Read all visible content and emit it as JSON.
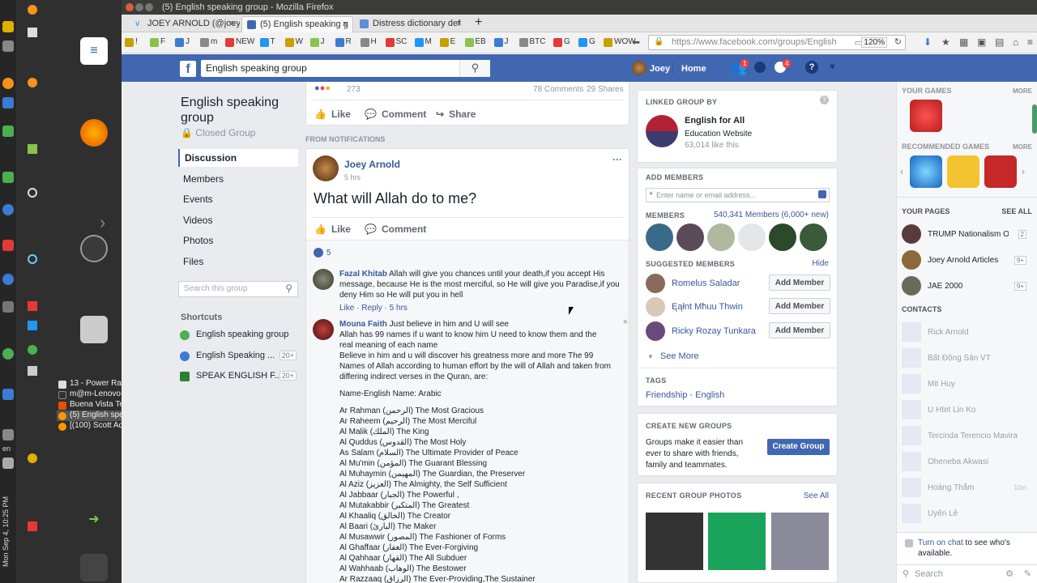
{
  "window": {
    "title": "(5) English speaking group - Mozilla Firefox"
  },
  "tabs": [
    {
      "label": "JOEY ARNOLD (@joey"
    },
    {
      "label": "(5) English speaking g"
    },
    {
      "label": "Distress dictionary def"
    }
  ],
  "bookmarks": [
    "!",
    "F",
    "J",
    "m",
    "NEW",
    "T",
    "W",
    "J",
    "R",
    "H",
    "SC",
    "M",
    "E",
    "EB",
    "J",
    "BTC",
    "G",
    "G",
    "WOW"
  ],
  "url": {
    "value": "https://www.facebook.com/groups/English",
    "zoom": "120%"
  },
  "taskbar": {
    "items": [
      "13 - Power Ran...",
      "m@m-Lenovo-...",
      "Buena Vista Te...",
      "(5) English spe...",
      "[(100) Scott Ad..."
    ],
    "clock": "Mon Sep 4, 10:25 PM",
    "lang": "en"
  },
  "fb": {
    "search_value": "English speaking group",
    "user": "Joey",
    "home": "Home",
    "friends_badge": "1",
    "notif_badge": "4"
  },
  "group": {
    "name": "English speaking group",
    "type": "Closed Group",
    "nav": [
      "Discussion",
      "Members",
      "Events",
      "Videos",
      "Photos",
      "Files"
    ],
    "search_placeholder": "Search this group",
    "shortcuts_title": "Shortcuts",
    "shortcuts": [
      {
        "label": "English speaking group",
        "count": ""
      },
      {
        "label": "English Speaking ...",
        "count": "20+"
      },
      {
        "label": "SPEAK ENGLISH F...",
        "count": "20+"
      }
    ]
  },
  "topcard": {
    "reactions": "273",
    "comments": "78 Comments",
    "shares": "29 Shares",
    "like": "Like",
    "comment": "Comment",
    "share": "Share"
  },
  "from_notifications": "FROM NOTIFICATIONS",
  "post": {
    "author": "Joey Arnold",
    "time": "5 hrs",
    "more": "···",
    "text": "What will Allah do to me?",
    "like": "Like",
    "comment": "Comment",
    "likes_count": "5"
  },
  "comments": [
    {
      "name": "Fazal Khitab",
      "text": "Allah will give you chances until your death,if you accept His message, because He is the most merciful, so He will give you Paradise,if you deny Him so He will put you in hell",
      "meta": "Like · Reply · 5 hrs"
    },
    {
      "name": "Mouna Faith",
      "first": "Just believe in him and U will see",
      "lines": [
        "Allah has 99 names if u want to know him U need to know them and the real meaning of each name",
        "Believe in him and u will discover his greatness more and more The 99 Names of Allah according to human effort by the will of Allah and taken from differing indirect verses in the Quran, are:",
        "",
        "Name-English Name: Arabic",
        "",
        "Ar Rahman (الرحمن) The Most Gracious",
        "Ar Raheem (الرحيم) The Most Merciful",
        "Al Malik (الملك) The King",
        "Al Quddus (القدوس) The Most Holy",
        "As Salam (السلام) The Ultimate Provider of Peace",
        "Al Mu'min (المؤمن) The Guarant Blessing",
        "Al Muhaymin (المهيمن) The Guardian, the Preserver",
        "Al Aziz (العزيز) The Almighty, the Self Sufficient",
        "Al Jabbaar (الجبار) The Powerful ,",
        "Al Mutakabbir (المتكبر) The Greatest",
        "Al Khaaliq (الخالق) The Creator",
        "Al Baari (البارئ) The Maker",
        "Al Musawwir (المصور) The Fashioner of Forms",
        "Al Ghaffaar (الغفار) The Ever-Forgiving",
        "Al Qahhaar (القهار) The All Subduer",
        "Al Wahhaab (الوهاب) The Bestower",
        "Ar Razzaaq (الرزاق) The Ever-Providing,The Sustainer"
      ]
    }
  ],
  "sidebar": {
    "linked_title": "LINKED GROUP BY",
    "linked_name": "English for All",
    "linked_type": "Education Website",
    "linked_likes": "63,014 like this",
    "add_members_title": "ADD MEMBERS",
    "add_placeholder": "Enter name or email address...",
    "members_title": "MEMBERS",
    "members_count": "540,341 Members (6,000+ new)",
    "suggested_title": "SUGGESTED MEMBERS",
    "hide": "Hide",
    "suggested": [
      {
        "name": "Romelus Saladar",
        "btn": "Add Member"
      },
      {
        "name": "Ęąłnt Mħuu Thwin",
        "btn": "Add Member"
      },
      {
        "name": "Ricky Rozay Tunkara",
        "btn": "Add Member"
      }
    ],
    "see_more": "See More",
    "tags_title": "TAGS",
    "tag1": "Friendship",
    "tag2": "English",
    "create_title": "CREATE NEW GROUPS",
    "create_text": "Groups make it easier than ever to share with friends, family and teammates.",
    "create_btn": "Create Group",
    "photos_title": "RECENT GROUP PHOTOS",
    "see_all": "See All"
  },
  "rail": {
    "games_title": "YOUR GAMES",
    "more": "MORE",
    "rec_title": "RECOMMENDED GAMES",
    "pages_title": "YOUR PAGES",
    "see_all": "SEE ALL",
    "pages": [
      {
        "name": "TRUMP Nationalism O...",
        "count": "2"
      },
      {
        "name": "Joey Arnold Articles",
        "count": "9+"
      },
      {
        "name": "JAE 2000",
        "count": "9+"
      }
    ],
    "contacts_title": "CONTACTS",
    "contacts": [
      {
        "name": "Rick Arnold",
        "time": ""
      },
      {
        "name": "Bất Động Sản VT",
        "time": ""
      },
      {
        "name": "Mit Huy",
        "time": ""
      },
      {
        "name": "U Htet Lin Ko",
        "time": ""
      },
      {
        "name": "Tercinda Terencio Mavira",
        "time": ""
      },
      {
        "name": "Oheneba Akwasi",
        "time": ""
      },
      {
        "name": "Hoàng Thắm",
        "time": "10m"
      },
      {
        "name": "Uyên Lê",
        "time": ""
      }
    ],
    "chat_text_link": "Turn on chat",
    "chat_text": " to see who's available.",
    "search_placeholder": "Search"
  }
}
